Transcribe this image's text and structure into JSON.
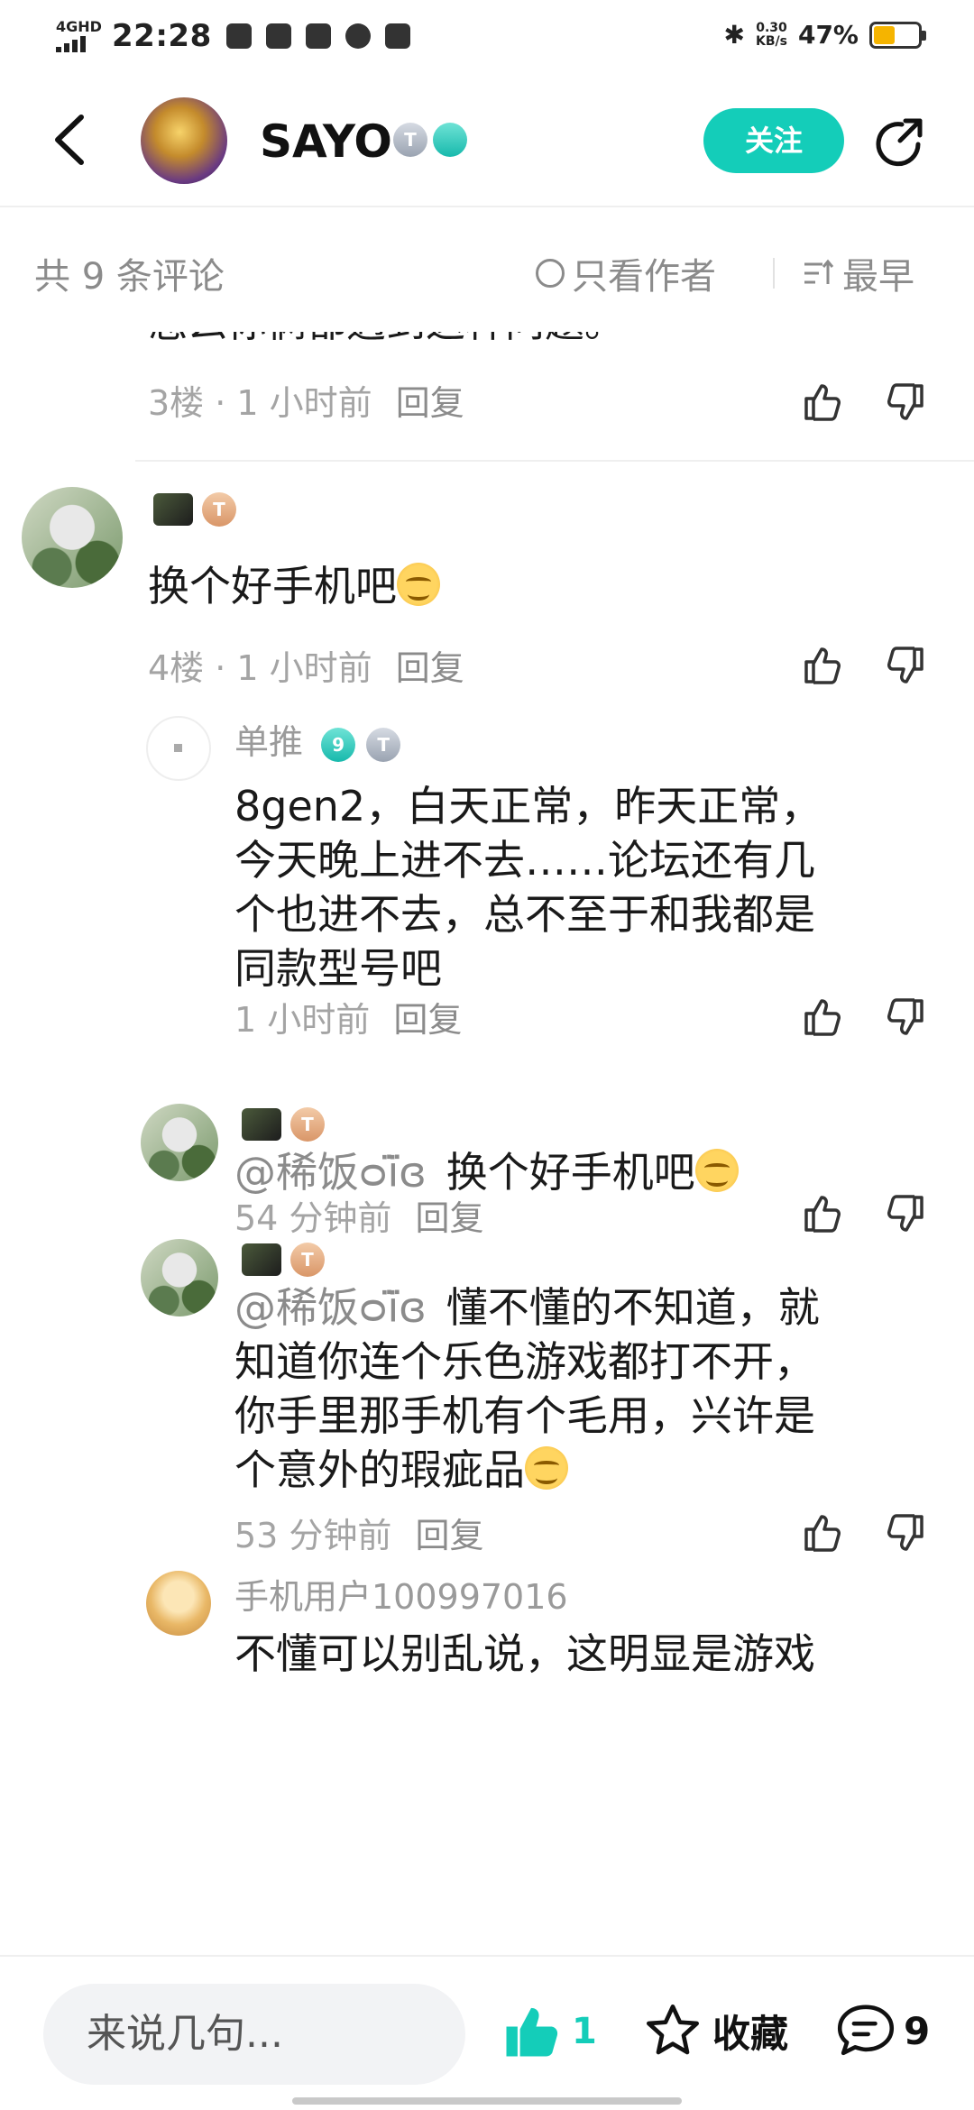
{
  "status_bar": {
    "network": "4GHD",
    "time": "22:28",
    "speed_value": "0.30",
    "speed_unit": "KB/s",
    "battery": "47%",
    "battery_level": 0.47,
    "battery_color": "#f5b400"
  },
  "header": {
    "author_name": "SAYO",
    "badge_1": "T",
    "follow_label": "关注"
  },
  "filter": {
    "comment_count": "共 9 条评论",
    "only_author": "只看作者",
    "sort": "最早"
  },
  "comments": {
    "c3": {
      "partial_text": "怎么你俩都遇到这种问题。",
      "time": "3楼 · 1 小时前",
      "reply": "回复"
    },
    "c4": {
      "text": "换个好手机吧",
      "time": "4楼 · 1 小时前",
      "reply": "回复",
      "badge": "T"
    },
    "r1": {
      "name": "单推",
      "badge_num": "9",
      "badge_t": "T",
      "line1": "8gen2，白天正常，昨天正常，",
      "line2": "今天晚上进不去……论坛还有几",
      "line3": "个也进不去，总不至于和我都是",
      "line4": "同款型号吧",
      "time": "1 小时前",
      "reply": "回复"
    },
    "r2": {
      "mention": "@稀饭ᴑï̈ɞ",
      "text": "换个好手机吧",
      "time": "54 分钟前",
      "reply": "回复",
      "badge": "T"
    },
    "r3": {
      "mention": "@稀饭ᴑï̈ɞ",
      "line1": "懂不懂的不知道，就",
      "line2": "知道你连个乐色游戏都打不开，",
      "line3": "你手里那手机有个毛用，兴许是",
      "line4": "个意外的瑕疵品",
      "time": "53 分钟前",
      "reply": "回复",
      "badge": "T"
    },
    "r4": {
      "name": "手机用户100997016",
      "line1": "不懂可以别乱说，这明显是游戏"
    }
  },
  "bottom_bar": {
    "input_placeholder": "来说几句...",
    "like_count": "1",
    "favorite_label": "收藏",
    "comment_count": "9",
    "accent_color": "#14cdb9"
  }
}
